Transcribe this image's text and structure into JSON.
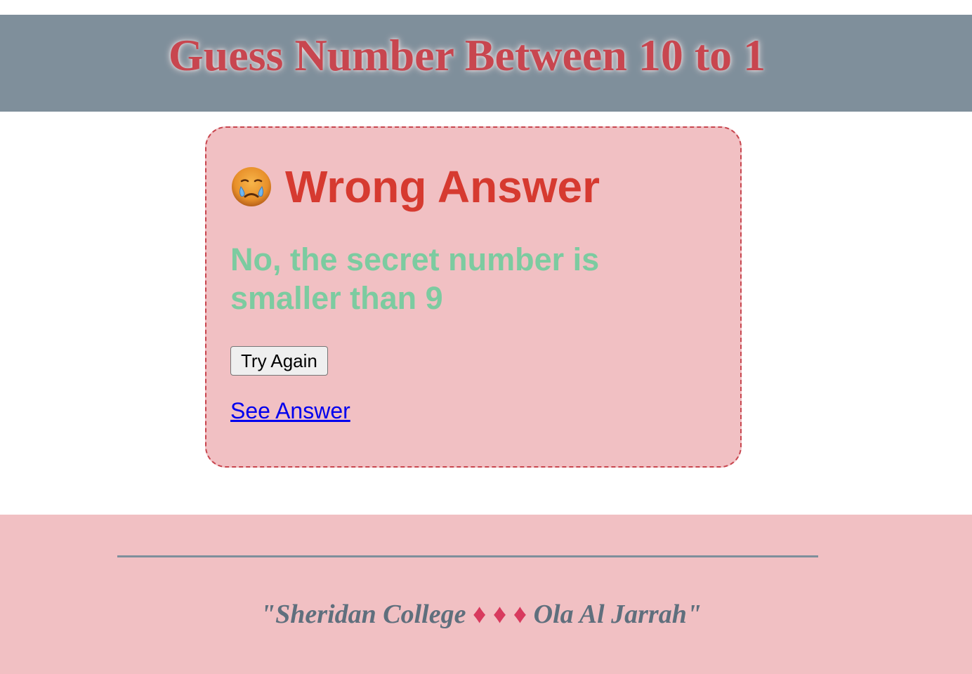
{
  "header": {
    "title": "Guess Number Between 10 to 1"
  },
  "result_card": {
    "icon": "crying-face-emoji",
    "heading": "Wrong Answer",
    "hint": "No, the secret number is smaller than 9",
    "try_again_label": "Try Again",
    "see_answer_label": "See Answer"
  },
  "footer": {
    "quote_open": "\"",
    "college": "Sheridan College",
    "diamonds": "♦ ♦ ♦",
    "author": "Ola Al Jarrah",
    "quote_close": "\""
  },
  "colors": {
    "header_bg": "#7f8f9b",
    "title_color": "#c8464f",
    "card_bg": "#f1c0c3",
    "heading_color": "#d63a30",
    "hint_color": "#7ccba0",
    "link_color": "#0000ee",
    "footer_bg": "#f1c0c3",
    "footer_text": "#5f6f7d",
    "diamond_color": "#d83a5e"
  }
}
